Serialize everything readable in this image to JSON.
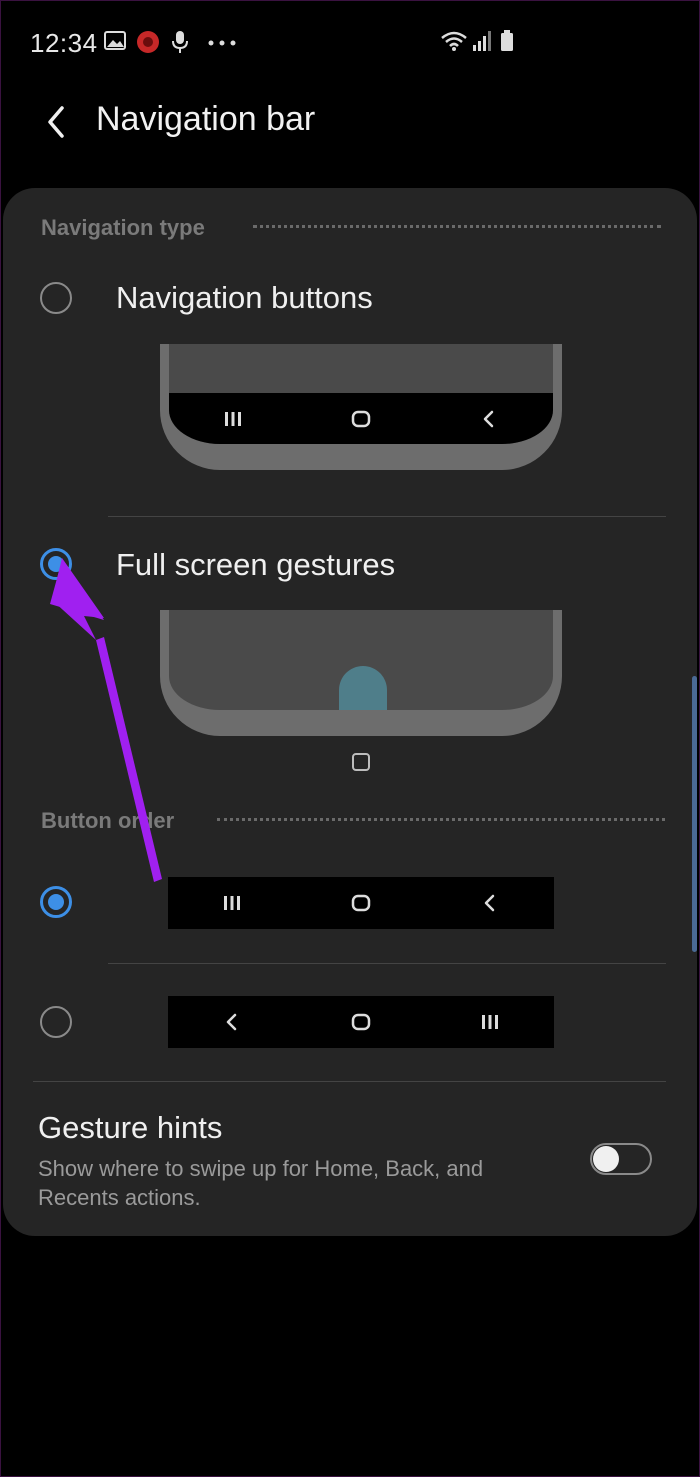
{
  "status_bar": {
    "time": "12:34",
    "icons": [
      "image-icon",
      "notification-badge-icon",
      "mic-icon",
      "more-icon",
      "wifi-icon",
      "signal-icon",
      "battery-icon"
    ]
  },
  "header": {
    "title": "Navigation bar"
  },
  "navigation_type": {
    "label": "Navigation type",
    "options": [
      {
        "label": "Navigation buttons",
        "selected": false,
        "preview": [
          "recents",
          "home",
          "back"
        ]
      },
      {
        "label": "Full screen gestures",
        "selected": true,
        "preview": [
          "gesture"
        ]
      }
    ]
  },
  "button_order": {
    "label": "Button order",
    "options": [
      {
        "selected": true,
        "buttons": [
          "recents",
          "home",
          "back"
        ]
      },
      {
        "selected": false,
        "buttons": [
          "back",
          "home",
          "recents"
        ]
      }
    ]
  },
  "gesture_hints": {
    "title": "Gesture hints",
    "description": "Show where to swipe up for Home, Back, and Recents actions.",
    "enabled": false
  },
  "colors": {
    "accent": "#3d8fe6",
    "annotation_arrow": "#a020f0",
    "card": "#252525"
  }
}
